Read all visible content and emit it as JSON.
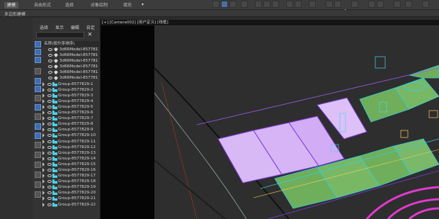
{
  "ribbon": {
    "tabs": [
      {
        "label": "建模",
        "active": true
      },
      {
        "label": "自由形式",
        "active": false
      },
      {
        "label": "选择",
        "active": false
      },
      {
        "label": "对象绘制",
        "active": false
      },
      {
        "label": "填充",
        "active": false
      }
    ],
    "sub_label": "多边形建模"
  },
  "scene_explorer": {
    "menu": [
      "选择",
      "显示",
      "编辑",
      "自定义"
    ],
    "search_placeholder": "",
    "column_header": "名称(按升序排序)",
    "items": [
      {
        "name": "3d66Model-857781",
        "level": 1
      },
      {
        "name": "3d66Model-857781",
        "level": 1
      },
      {
        "name": "3d66Model-857781",
        "level": 1
      },
      {
        "name": "3d66Model-857781",
        "level": 1
      },
      {
        "name": "3d66Model-857781",
        "level": 1
      },
      {
        "name": "3d66Model-857781",
        "level": 1
      },
      {
        "name": "Group-8577829-1",
        "level": 0
      },
      {
        "name": "Group-8577829-2",
        "level": 0
      },
      {
        "name": "Group-8577829-3",
        "level": 0
      },
      {
        "name": "Group-8577829-4",
        "level": 0
      },
      {
        "name": "Group-8577829-5",
        "level": 0
      },
      {
        "name": "Group-8577829-6",
        "level": 0
      },
      {
        "name": "Group-8577829-7",
        "level": 0
      },
      {
        "name": "Group-8577829-8",
        "level": 0
      },
      {
        "name": "Group-8577829-9",
        "level": 0
      },
      {
        "name": "Group-8577829-10",
        "level": 0
      },
      {
        "name": "Group-8577829-11",
        "level": 0
      },
      {
        "name": "Group-8577829-12",
        "level": 0
      },
      {
        "name": "Group-8577829-13",
        "level": 0
      },
      {
        "name": "Group-8577829-14",
        "level": 0
      },
      {
        "name": "Group-8577829-15",
        "level": 0
      },
      {
        "name": "Group-8577829-16",
        "level": 0
      },
      {
        "name": "Group-8577829-17",
        "level": 0
      },
      {
        "name": "Group-8577829-18",
        "level": 0
      },
      {
        "name": "Group-8577829-19",
        "level": 0
      },
      {
        "name": "Group-8577829-20",
        "level": 0
      },
      {
        "name": "Group-8577829-21",
        "level": 0
      },
      {
        "name": "Group-8577829-22",
        "level": 0
      }
    ]
  },
  "viewport": {
    "label": "[+] [Camera002] [用户定义] [线框]"
  },
  "colors": {
    "accent": "#3d6db4",
    "selection_cyan": "#4dd4e8",
    "wire_purple": "#9b5cf0",
    "grass_green": "#6fae5a"
  }
}
